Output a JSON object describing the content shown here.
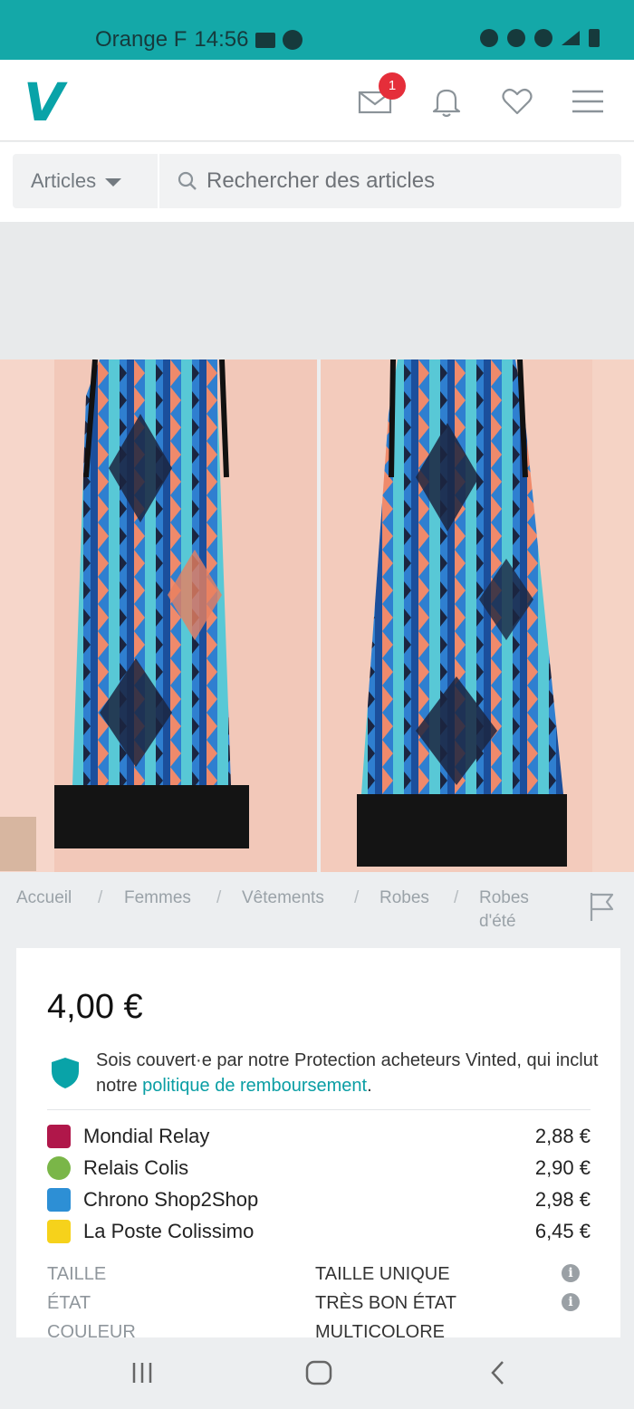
{
  "status_bar": {
    "carrier": "Orange F",
    "time": "14:56"
  },
  "header": {
    "logo": "V",
    "notification_count": "1",
    "icons": [
      "mail-icon",
      "bell-icon",
      "heart-icon",
      "menu-icon"
    ]
  },
  "search": {
    "category_label": "Articles",
    "placeholder": "Rechercher des articles"
  },
  "breadcrumb": {
    "items": [
      "Accueil",
      "Femmes",
      "Vêtements",
      "Robes",
      "Robes",
      "d'été"
    ],
    "separator": "/"
  },
  "listing": {
    "price": "4,00 €",
    "protection_text": "Sois couvert·e par notre Protection acheteurs Vinted, qui inclut notre ",
    "protection_link": "politique de remboursement",
    "protection_end": ".",
    "shipping": [
      {
        "name": "Mondial Relay",
        "price": "2,88 €",
        "color": "#b0174a"
      },
      {
        "name": "Relais Colis",
        "price": "2,90 €",
        "color": "#7ab648"
      },
      {
        "name": "Chrono Shop2Shop",
        "price": "2,98 €",
        "color": "#2d8fd5"
      },
      {
        "name": "La Poste Colissimo",
        "price": "6,45 €",
        "color": "#f6d21b"
      }
    ],
    "attributes": [
      {
        "key": "TAILLE",
        "value": "TAILLE UNIQUE"
      },
      {
        "key": "ÉTAT",
        "value": "TRÈS BON ÉTAT"
      },
      {
        "key": "COULEUR",
        "value": "MULTICOLORE"
      }
    ]
  },
  "colors": {
    "brand": "#09a3a8",
    "status_bar": "#14a8a8",
    "badge": "#e52e3a"
  }
}
